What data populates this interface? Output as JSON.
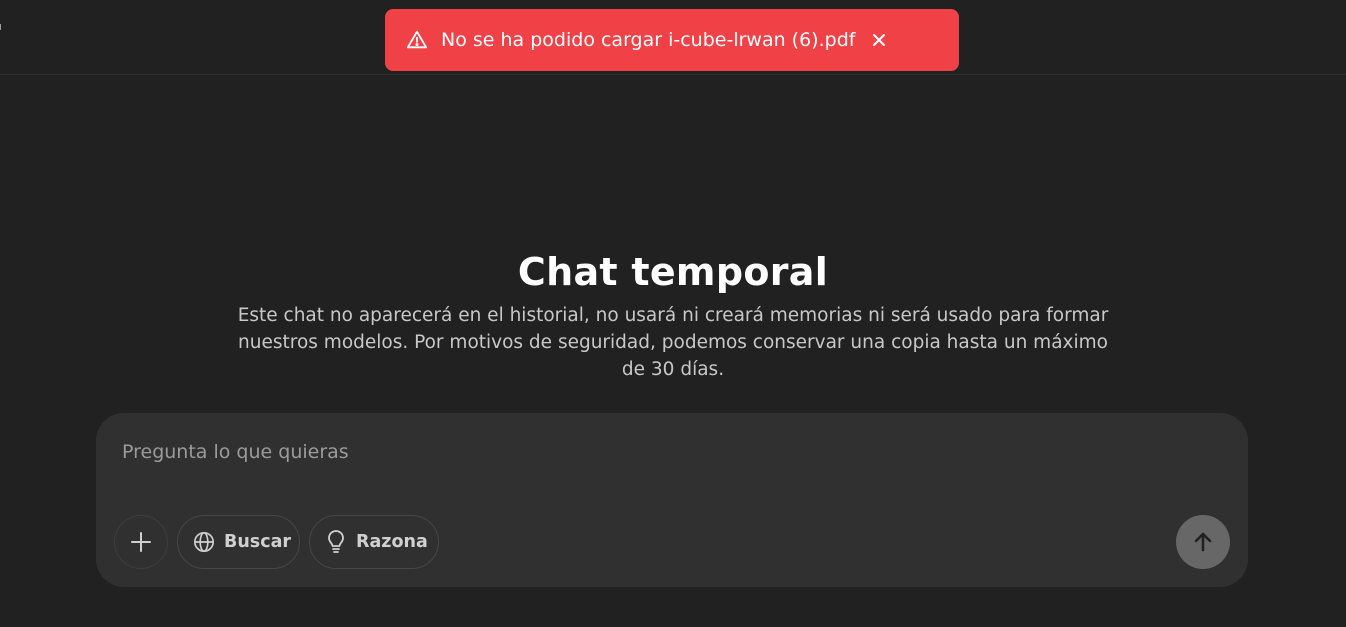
{
  "toast": {
    "message": "No se ha podido cargar i-cube-lrwan (6).pdf",
    "icon": "warning-icon",
    "close_icon": "close-icon",
    "color": "#ef4146"
  },
  "hero": {
    "title": "Chat temporal",
    "description": "Este chat no aparecerá en el historial, no usará ni creará memorias ni será usado para formar nuestros modelos. Por motivos de seguridad, podemos conservar una copia hasta un máximo de 30 días."
  },
  "composer": {
    "placeholder": "Pregunta lo que quieras",
    "value": "",
    "tools": {
      "attach_icon": "plus-icon",
      "search_label": "Buscar",
      "search_icon": "globe-icon",
      "reason_label": "Razona",
      "reason_icon": "lightbulb-icon"
    },
    "send_icon": "arrow-up-icon"
  },
  "theme": {
    "background": "#212121",
    "composer_background": "#303030",
    "send_button": "#676767"
  }
}
